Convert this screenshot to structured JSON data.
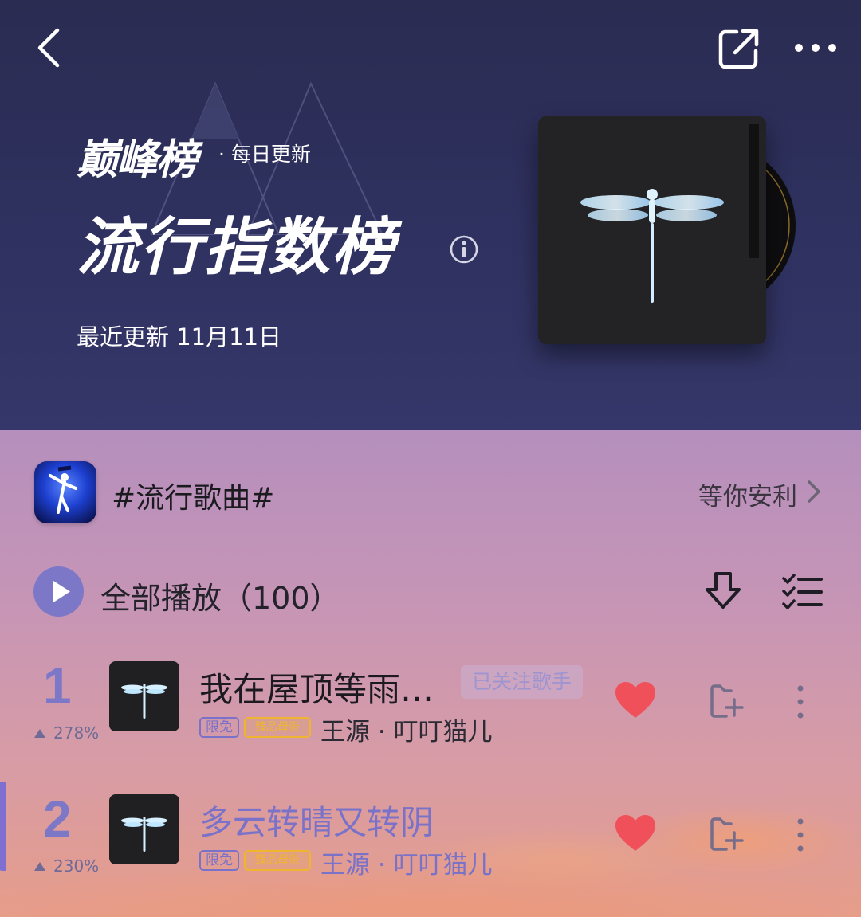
{
  "header": {
    "brand": "巅峰榜",
    "brand_sub": "· 每日更新",
    "title": "流行指数榜",
    "update_text": "最近更新 11月11日"
  },
  "topic": {
    "name": "#流行歌曲#",
    "link_text": "等你安利"
  },
  "toolbar": {
    "play_all_label": "全部播放（100）"
  },
  "songs": [
    {
      "rank": "1",
      "trend": "278%",
      "title": "我在屋顶等雨…",
      "follow_badge": "已关注歌手",
      "tag_free": "限免",
      "tag_quality": "臻品母带",
      "artist": "王源 · 叮叮猫儿",
      "playing": false
    },
    {
      "rank": "2",
      "trend": "230%",
      "title": "多云转晴又转阴",
      "tag_free": "限免",
      "tag_quality": "臻品母带",
      "artist": "王源 · 叮叮猫儿",
      "playing": true
    }
  ],
  "colors": {
    "accent": "#7d77c8",
    "like": "#f0505a",
    "header_bg": "#2e305c"
  },
  "icons": [
    "back-icon",
    "share-icon",
    "more-icon",
    "info-icon",
    "play-icon",
    "download-icon",
    "multi-select-icon",
    "heart-icon",
    "add-to-playlist-icon",
    "more-vertical-icon",
    "chevron-right-icon"
  ]
}
